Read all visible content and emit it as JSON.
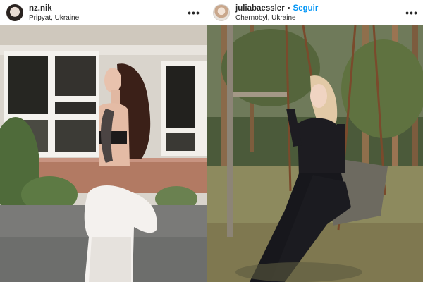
{
  "posts": [
    {
      "username": "nz.nik",
      "location": "Pripyat, Ukraine",
      "more_icon": "more-horizontal-icon",
      "photo_subject": "post-photo"
    },
    {
      "username": "juliabaessler",
      "separator": "•",
      "follow_label": "Seguir",
      "location": "Chernobyl, Ukraine",
      "more_icon": "more-horizontal-icon",
      "photo_subject": "post-photo"
    }
  ],
  "colors": {
    "follow_blue": "#0095f6",
    "text_primary": "#262626",
    "divider": "#dbdbdb"
  }
}
